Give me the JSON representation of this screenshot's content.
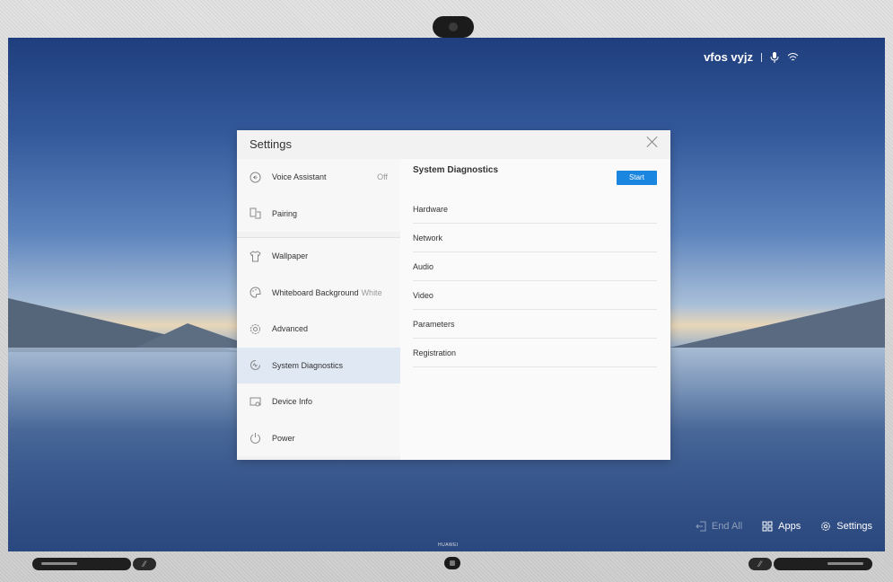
{
  "status_bar": {
    "user_name": "vfos vyjz",
    "mic_icon": "microphone-icon",
    "wifi_icon": "wifi-icon"
  },
  "dialog": {
    "title": "Settings",
    "close_icon": "close-icon",
    "nav_groups": [
      [
        {
          "label": "Voice Assistant",
          "value": "Off",
          "icon": "voice-assistant-icon"
        },
        {
          "label": "Pairing",
          "icon": "pairing-icon"
        }
      ],
      [
        {
          "label": "Wallpaper",
          "icon": "shirt-icon"
        },
        {
          "label": "Whiteboard Background",
          "value": "White",
          "icon": "palette-icon"
        },
        {
          "label": "Advanced",
          "icon": "gear-icon"
        },
        {
          "label": "System Diagnostics",
          "icon": "diagnostics-icon",
          "active": true
        },
        {
          "label": "Device Info",
          "icon": "device-info-icon"
        },
        {
          "label": "Power",
          "icon": "power-icon"
        }
      ]
    ],
    "panel": {
      "title": "System Diagnostics",
      "start_label": "Start",
      "items": [
        "Hardware",
        "Network",
        "Audio",
        "Video",
        "Parameters",
        "Registration"
      ]
    }
  },
  "taskbar": {
    "end_all": "End All",
    "apps": "Apps",
    "settings": "Settings"
  },
  "brand": "HUAWEI",
  "colors": {
    "accent": "#1a86e0",
    "active_row": "#dfe8f3"
  }
}
